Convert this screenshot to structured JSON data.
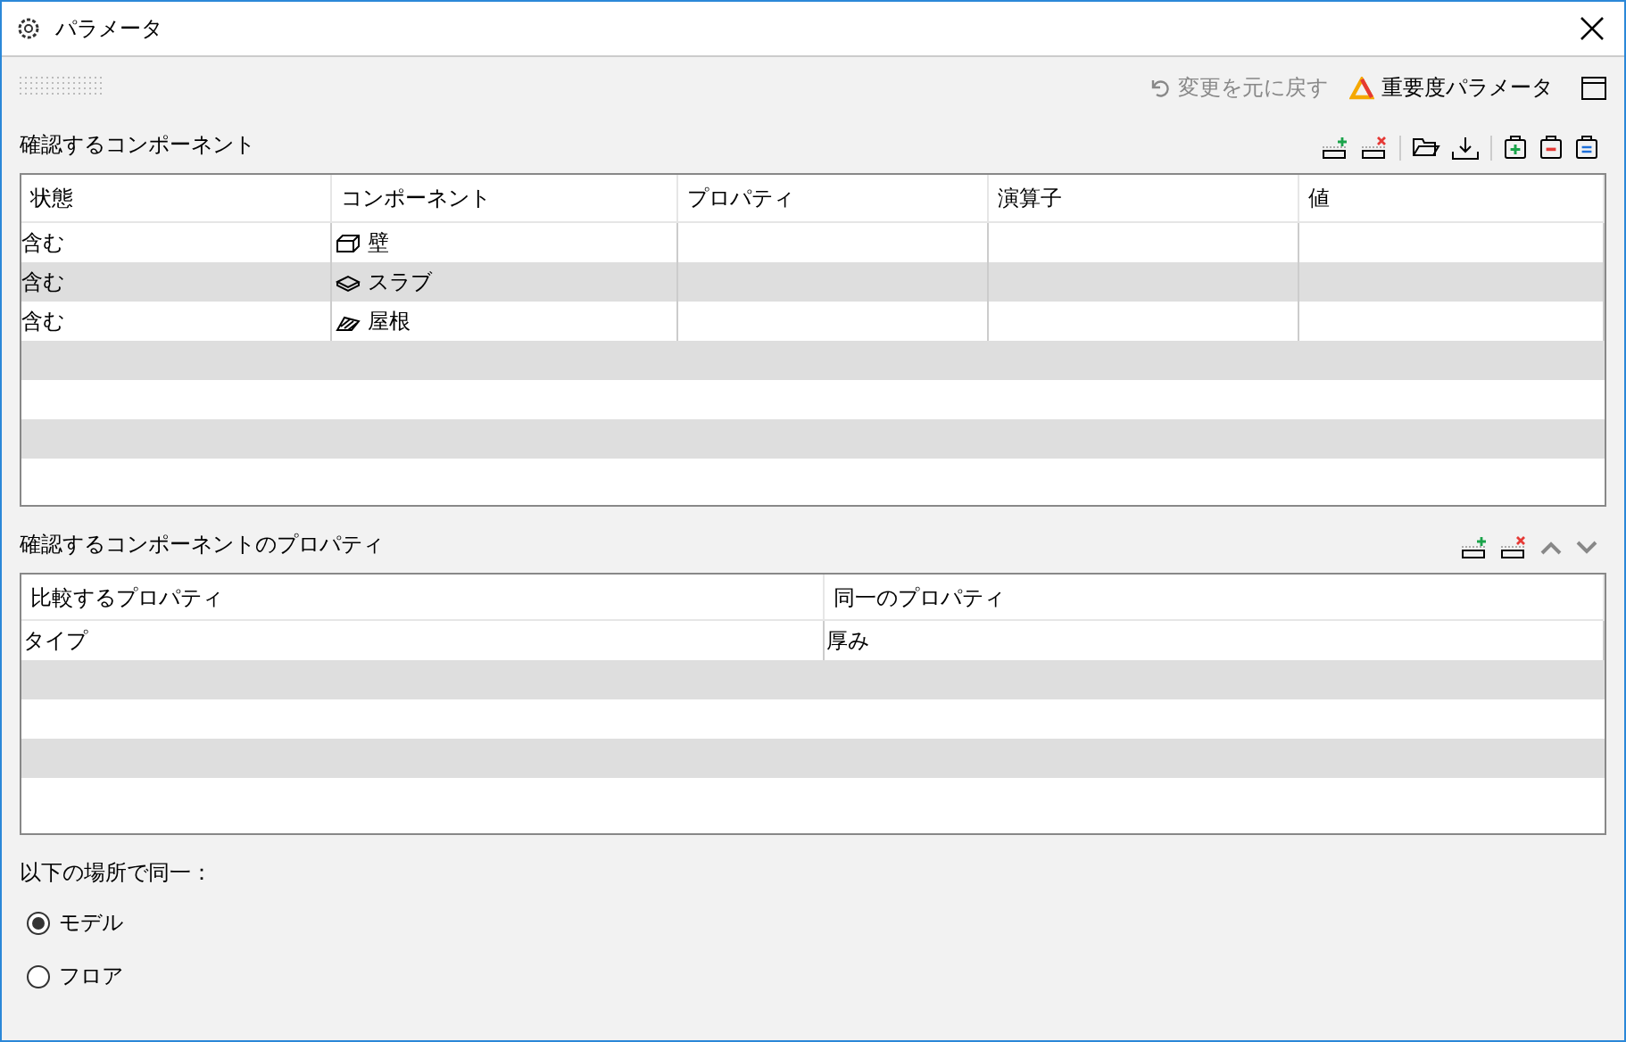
{
  "window": {
    "title": "パラメータ"
  },
  "toolbar": {
    "undo": {
      "label": "変更を元に戻す",
      "disabled": true
    },
    "importance": {
      "label": "重要度パラメータ"
    }
  },
  "components": {
    "title": "確認するコンポーネント",
    "columns": [
      "状態",
      "コンポーネント",
      "プロパティ",
      "演算子",
      "値"
    ],
    "rows": [
      {
        "state": "含む",
        "component": "壁",
        "kind": "wall",
        "property": "",
        "operator": "",
        "value": ""
      },
      {
        "state": "含む",
        "component": "スラブ",
        "kind": "slab",
        "property": "",
        "operator": "",
        "value": ""
      },
      {
        "state": "含む",
        "component": "屋根",
        "kind": "roof",
        "property": "",
        "operator": "",
        "value": ""
      }
    ]
  },
  "properties": {
    "title": "確認するコンポーネントのプロパティ",
    "columns": [
      "比較するプロパティ",
      "同一のプロパティ"
    ],
    "rows": [
      [
        "タイプ",
        "厚み"
      ]
    ]
  },
  "same_in": {
    "label": "以下の場所で同一：",
    "options": [
      {
        "label": "モデル",
        "selected": true
      },
      {
        "label": "フロア",
        "selected": false
      }
    ]
  }
}
